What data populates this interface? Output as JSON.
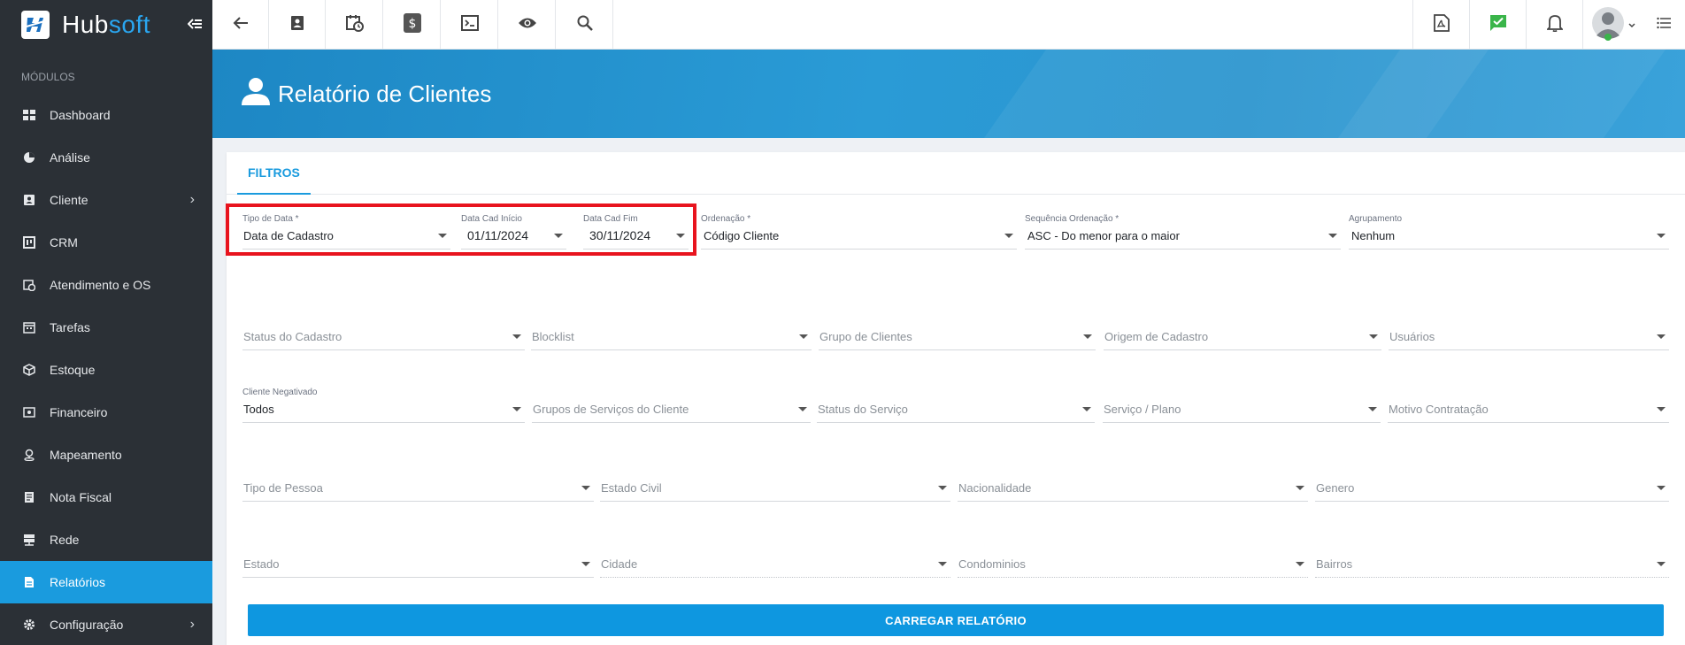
{
  "sidebar": {
    "brand_hub": "Hub",
    "brand_soft": "soft",
    "section_label": "MÓDULOS",
    "items": [
      {
        "label": "Dashboard",
        "icon": "grid-icon"
      },
      {
        "label": "Análise",
        "icon": "pie-chart-icon"
      },
      {
        "label": "Cliente",
        "icon": "contact-card-icon",
        "has_submenu": true
      },
      {
        "label": "CRM",
        "icon": "kanban-icon"
      },
      {
        "label": "Atendimento e OS",
        "icon": "calendar-clock-icon"
      },
      {
        "label": "Tarefas",
        "icon": "calendar-tasks-icon"
      },
      {
        "label": "Estoque",
        "icon": "box-icon"
      },
      {
        "label": "Financeiro",
        "icon": "money-icon"
      },
      {
        "label": "Mapeamento",
        "icon": "map-pin-icon"
      },
      {
        "label": "Nota Fiscal",
        "icon": "receipt-icon"
      },
      {
        "label": "Rede",
        "icon": "server-icon"
      },
      {
        "label": "Relatórios",
        "icon": "document-icon",
        "active": true
      },
      {
        "label": "Configuração",
        "icon": "gear-icon",
        "has_submenu": true
      }
    ]
  },
  "topbar": {
    "left_icons": [
      "back-arrow-icon",
      "contact-icon",
      "calendar-clock-icon",
      "dollar-icon",
      "terminal-icon",
      "eye-icon",
      "search-icon"
    ],
    "right_icons": [
      "pdf-icon",
      "checkmark-chat-icon",
      "bell-icon",
      "user-avatar",
      "list-menu-icon"
    ]
  },
  "page": {
    "title": "Relatório de Clientes"
  },
  "tabs": [
    "FILTROS"
  ],
  "filters": {
    "tipo_data": {
      "label": "Tipo de Data *",
      "value": "Data de Cadastro"
    },
    "data_cad_inicio": {
      "label": "Data Cad Início",
      "value": "01/11/2024"
    },
    "data_cad_fim": {
      "label": "Data Cad Fim",
      "value": "30/11/2024"
    },
    "ordenacao": {
      "label": "Ordenação *",
      "value": "Código Cliente"
    },
    "sequencia_ordenacao": {
      "label": "Sequência Ordenação *",
      "value": "ASC - Do menor para o maior"
    },
    "agrupamento": {
      "label": "Agrupamento",
      "value": "Nenhum"
    },
    "status_cadastro": {
      "placeholder": "Status do Cadastro"
    },
    "blocklist": {
      "placeholder": "Blocklist"
    },
    "grupo_clientes": {
      "placeholder": "Grupo de Clientes"
    },
    "origem_cadastro": {
      "placeholder": "Origem de Cadastro"
    },
    "usuarios": {
      "placeholder": "Usuários"
    },
    "cliente_negativado": {
      "label": "Cliente Negativado",
      "value": "Todos"
    },
    "grupos_servicos": {
      "placeholder": "Grupos de Serviços do Cliente"
    },
    "status_servico": {
      "placeholder": "Status do Serviço"
    },
    "servico_plano": {
      "placeholder": "Serviço / Plano"
    },
    "motivo_contratacao": {
      "placeholder": "Motivo Contratação"
    },
    "tipo_pessoa": {
      "placeholder": "Tipo de Pessoa"
    },
    "estado_civil": {
      "placeholder": "Estado Civil"
    },
    "nacionalidade": {
      "placeholder": "Nacionalidade"
    },
    "genero": {
      "placeholder": "Genero"
    },
    "estado": {
      "placeholder": "Estado"
    },
    "cidade": {
      "placeholder": "Cidade"
    },
    "condominios": {
      "placeholder": "Condominios"
    },
    "bairros": {
      "placeholder": "Bairros"
    }
  },
  "actions": {
    "load_report": "CARREGAR RELATÓRIO"
  },
  "colors": {
    "accent": "#1a9bde",
    "sidebar_bg": "#2b3036",
    "highlight": "#e8141e"
  }
}
